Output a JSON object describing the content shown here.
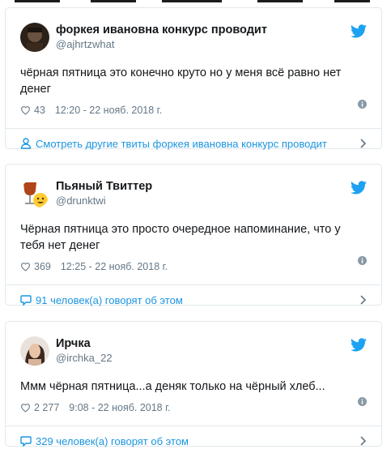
{
  "colors": {
    "accent": "#1b95e0",
    "secondary_text": "#657786",
    "border": "#e1e8ed"
  },
  "tweets": [
    {
      "name": "форкея ивановна конкурс проводит",
      "handle": "@ajhrtzwhat",
      "text": "чёрная пятница это конечно круто но у меня всё равно нет денег",
      "likes": "43",
      "time": "12:20 - 22 нояб. 2018 г.",
      "footer": "Смотреть другие твиты форкея ивановна конкурс проводит",
      "footer_icon": "person-icon"
    },
    {
      "name": "Пьяный Твиттер",
      "handle": "@drunktwi",
      "text": "Чёрная пятница это просто очередное напоминание, что у тебя нет денег",
      "likes": "369",
      "time": "12:25 - 22 нояб. 2018 г.",
      "footer": "91 человек(а) говорят об этом",
      "footer_icon": "speech-bubble-icon"
    },
    {
      "name": "Ирчка",
      "handle": "@irchka_22",
      "text": "Ммм чёрная пятница...а деняк только на чёрный хлеб...",
      "likes": "2 277",
      "time": "9:08 - 22 нояб. 2018 г.",
      "footer": "329 человек(а) говорят об этом",
      "footer_icon": "speech-bubble-icon"
    }
  ]
}
